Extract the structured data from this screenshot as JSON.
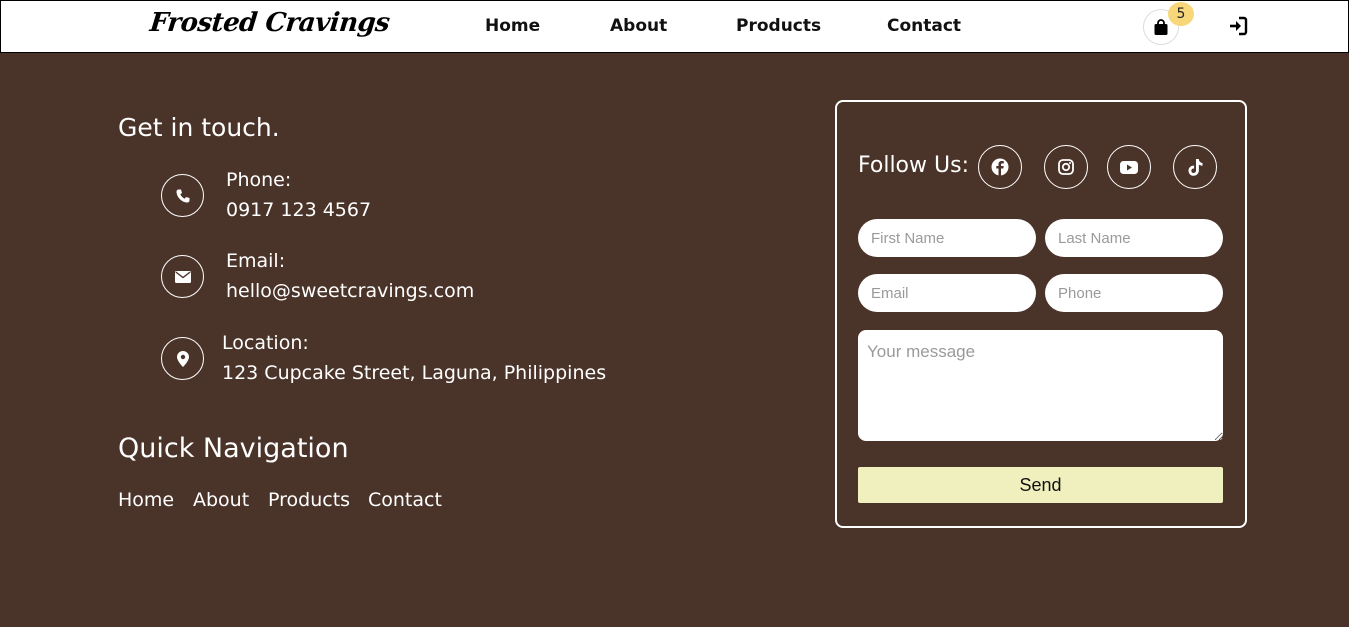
{
  "header": {
    "logo": "Frosted Cravings",
    "nav": [
      "Home",
      "About",
      "Products",
      "Contact"
    ],
    "cart_count": "5"
  },
  "contact": {
    "heading": "Get in touch.",
    "items": [
      {
        "label": "Phone:",
        "value": "0917 123 4567",
        "icon": "phone-icon"
      },
      {
        "label": "Email:",
        "value": "hello@sweetcravings.com",
        "icon": "envelope-icon"
      },
      {
        "label": "Location:",
        "value": "123 Cupcake Street, Laguna, Philippines",
        "icon": "location-pin-icon"
      }
    ]
  },
  "quick_nav": {
    "heading": "Quick Navigation",
    "links": [
      "Home",
      "About",
      "Products",
      "Contact"
    ]
  },
  "form": {
    "follow_label": "Follow Us:",
    "socials": [
      "facebook-icon",
      "instagram-icon",
      "youtube-icon",
      "tiktok-icon"
    ],
    "first_name_placeholder": "First Name",
    "last_name_placeholder": "Last Name",
    "email_placeholder": "Email",
    "phone_placeholder": "Phone",
    "message_placeholder": "Your message",
    "send_label": "Send"
  },
  "colors": {
    "background": "#4a3329",
    "badge": "#f7d779",
    "send_button": "#eff0bd"
  }
}
